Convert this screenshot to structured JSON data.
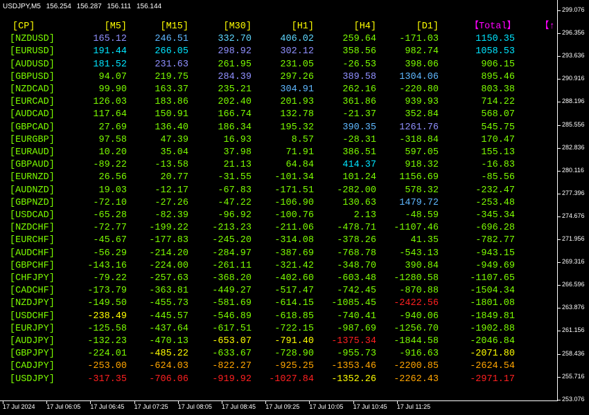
{
  "window": {
    "symbol": "USDJPY,M5",
    "prices": [
      "156.254",
      "156.287",
      "156.111",
      "156.144"
    ]
  },
  "columns": [
    "[CP]",
    "[M5]",
    "[M15]",
    "[M30]",
    "[H1]",
    "[H4]",
    "[D1]",
    "【Total】",
    "【↑"
  ],
  "header_colors": [
    "#ffff00",
    "#ffff00",
    "#ffff00",
    "#ffff00",
    "#ffff00",
    "#ffff00",
    "#ffff00",
    "#ff00ff",
    "#ff00ff"
  ],
  "rows": [
    {
      "pair": "[NZDUSD]",
      "values": [
        "165.12",
        "246.51",
        "332.70",
        "406.02",
        "259.64",
        "-171.03",
        "1150.35"
      ],
      "colors": [
        "#9090ff",
        "#5fb8ff",
        "#5fd8ff",
        "#5fd8ff",
        "#7cfc00",
        "#7cfc00",
        "#00e5ff"
      ]
    },
    {
      "pair": "[EURUSD]",
      "values": [
        "191.44",
        "266.05",
        "298.92",
        "302.12",
        "358.56",
        "982.74",
        "1058.53"
      ],
      "colors": [
        "#00e5ff",
        "#00e5ff",
        "#9090ff",
        "#9090ff",
        "#7cfc00",
        "#7cfc00",
        "#00e5ff"
      ]
    },
    {
      "pair": "[AUDUSD]",
      "values": [
        "181.52",
        "231.63",
        "261.95",
        "231.05",
        "-26.53",
        "398.06",
        "906.15"
      ],
      "colors": [
        "#00e5ff",
        "#9090ff",
        "#7cfc00",
        "#7cfc00",
        "#7cfc00",
        "#7cfc00",
        "#7cfc00"
      ]
    },
    {
      "pair": "[GBPUSD]",
      "values": [
        "94.07",
        "219.75",
        "284.39",
        "297.26",
        "389.58",
        "1304.06",
        "895.46"
      ],
      "colors": [
        "#7cfc00",
        "#7cfc00",
        "#9090ff",
        "#7cfc00",
        "#9090ff",
        "#5fb8ff",
        "#7cfc00"
      ]
    },
    {
      "pair": "[NZDCAD]",
      "values": [
        "99.90",
        "163.37",
        "235.21",
        "304.91",
        "262.16",
        "-220.80",
        "803.38"
      ],
      "colors": [
        "#7cfc00",
        "#7cfc00",
        "#7cfc00",
        "#5fb8ff",
        "#7cfc00",
        "#7cfc00",
        "#7cfc00"
      ]
    },
    {
      "pair": "[EURCAD]",
      "values": [
        "126.03",
        "183.86",
        "202.40",
        "201.93",
        "361.86",
        "939.93",
        "714.22"
      ],
      "colors": [
        "#7cfc00",
        "#7cfc00",
        "#7cfc00",
        "#7cfc00",
        "#7cfc00",
        "#7cfc00",
        "#7cfc00"
      ]
    },
    {
      "pair": "[AUDCAD]",
      "values": [
        "117.64",
        "150.91",
        "166.74",
        "132.78",
        "-21.37",
        "352.84",
        "568.07"
      ],
      "colors": [
        "#7cfc00",
        "#7cfc00",
        "#7cfc00",
        "#7cfc00",
        "#7cfc00",
        "#7cfc00",
        "#7cfc00"
      ]
    },
    {
      "pair": "[GBPCAD]",
      "values": [
        "27.69",
        "136.40",
        "186.34",
        "195.32",
        "390.35",
        "1261.76",
        "545.75"
      ],
      "colors": [
        "#7cfc00",
        "#7cfc00",
        "#7cfc00",
        "#7cfc00",
        "#5fb8ff",
        "#9090ff",
        "#7cfc00"
      ]
    },
    {
      "pair": "[EURGBP]",
      "values": [
        "97.58",
        "47.39",
        "16.93",
        "8.57",
        "-28.31",
        "-318.84",
        "170.47"
      ],
      "colors": [
        "#7cfc00",
        "#7cfc00",
        "#7cfc00",
        "#7cfc00",
        "#7cfc00",
        "#7cfc00",
        "#7cfc00"
      ]
    },
    {
      "pair": "[EURAUD]",
      "values": [
        "10.20",
        "35.04",
        "37.98",
        "71.91",
        "386.51",
        "597.05",
        "155.13"
      ],
      "colors": [
        "#7cfc00",
        "#7cfc00",
        "#7cfc00",
        "#7cfc00",
        "#7cfc00",
        "#7cfc00",
        "#7cfc00"
      ]
    },
    {
      "pair": "[GBPAUD]",
      "values": [
        "-89.22",
        "-13.58",
        "21.13",
        "64.84",
        "414.37",
        "918.32",
        "-16.83"
      ],
      "colors": [
        "#7cfc00",
        "#7cfc00",
        "#7cfc00",
        "#7cfc00",
        "#00e5ff",
        "#7cfc00",
        "#7cfc00"
      ]
    },
    {
      "pair": "[EURNZD]",
      "values": [
        "26.56",
        "20.77",
        "-31.55",
        "-101.34",
        "101.24",
        "1156.69",
        "-85.56"
      ],
      "colors": [
        "#7cfc00",
        "#7cfc00",
        "#7cfc00",
        "#7cfc00",
        "#7cfc00",
        "#7cfc00",
        "#7cfc00"
      ]
    },
    {
      "pair": "[AUDNZD]",
      "values": [
        "19.03",
        "-12.17",
        "-67.83",
        "-171.51",
        "-282.00",
        "578.32",
        "-232.47"
      ],
      "colors": [
        "#7cfc00",
        "#7cfc00",
        "#7cfc00",
        "#7cfc00",
        "#7cfc00",
        "#7cfc00",
        "#7cfc00"
      ]
    },
    {
      "pair": "[GBPNZD]",
      "values": [
        "-72.10",
        "-27.26",
        "-47.22",
        "-106.90",
        "130.63",
        "1479.72",
        "-253.48"
      ],
      "colors": [
        "#7cfc00",
        "#7cfc00",
        "#7cfc00",
        "#7cfc00",
        "#7cfc00",
        "#5fb8ff",
        "#7cfc00"
      ]
    },
    {
      "pair": "[USDCAD]",
      "values": [
        "-65.28",
        "-82.39",
        "-96.92",
        "-100.76",
        "2.13",
        "-48.59",
        "-345.34"
      ],
      "colors": [
        "#7cfc00",
        "#7cfc00",
        "#7cfc00",
        "#7cfc00",
        "#7cfc00",
        "#7cfc00",
        "#7cfc00"
      ]
    },
    {
      "pair": "[NZDCHF]",
      "values": [
        "-72.77",
        "-199.22",
        "-213.23",
        "-211.06",
        "-478.71",
        "-1107.46",
        "-696.28"
      ],
      "colors": [
        "#7cfc00",
        "#7cfc00",
        "#7cfc00",
        "#7cfc00",
        "#7cfc00",
        "#7cfc00",
        "#7cfc00"
      ]
    },
    {
      "pair": "[EURCHF]",
      "values": [
        "-45.67",
        "-177.83",
        "-245.20",
        "-314.08",
        "-378.26",
        "41.35",
        "-782.77"
      ],
      "colors": [
        "#7cfc00",
        "#7cfc00",
        "#7cfc00",
        "#7cfc00",
        "#7cfc00",
        "#7cfc00",
        "#7cfc00"
      ]
    },
    {
      "pair": "[AUDCHF]",
      "values": [
        "-56.29",
        "-214.20",
        "-284.97",
        "-387.69",
        "-768.78",
        "-543.13",
        "-943.15"
      ],
      "colors": [
        "#7cfc00",
        "#7cfc00",
        "#7cfc00",
        "#7cfc00",
        "#7cfc00",
        "#7cfc00",
        "#7cfc00"
      ]
    },
    {
      "pair": "[GBPCHF]",
      "values": [
        "-143.16",
        "-224.00",
        "-261.11",
        "-321.42",
        "-348.70",
        "390.84",
        "-949.69"
      ],
      "colors": [
        "#7cfc00",
        "#7cfc00",
        "#7cfc00",
        "#7cfc00",
        "#7cfc00",
        "#7cfc00",
        "#7cfc00"
      ]
    },
    {
      "pair": "[CHFJPY]",
      "values": [
        "-79.22",
        "-257.63",
        "-368.20",
        "-402.60",
        "-603.48",
        "-1280.58",
        "-1107.65"
      ],
      "colors": [
        "#7cfc00",
        "#7cfc00",
        "#7cfc00",
        "#7cfc00",
        "#7cfc00",
        "#7cfc00",
        "#7cfc00"
      ]
    },
    {
      "pair": "[CADCHF]",
      "values": [
        "-173.79",
        "-363.81",
        "-449.27",
        "-517.47",
        "-742.45",
        "-870.88",
        "-1504.34"
      ],
      "colors": [
        "#7cfc00",
        "#7cfc00",
        "#7cfc00",
        "#7cfc00",
        "#7cfc00",
        "#7cfc00",
        "#7cfc00"
      ]
    },
    {
      "pair": "[NZDJPY]",
      "values": [
        "-149.50",
        "-455.73",
        "-581.69",
        "-614.15",
        "-1085.45",
        "-2422.56",
        "-1801.08"
      ],
      "colors": [
        "#7cfc00",
        "#7cfc00",
        "#7cfc00",
        "#7cfc00",
        "#7cfc00",
        "#ff2020",
        "#7cfc00"
      ]
    },
    {
      "pair": "[USDCHF]",
      "values": [
        "-238.49",
        "-445.57",
        "-546.89",
        "-618.85",
        "-740.41",
        "-940.06",
        "-1849.81"
      ],
      "colors": [
        "#ffff00",
        "#7cfc00",
        "#7cfc00",
        "#7cfc00",
        "#7cfc00",
        "#7cfc00",
        "#7cfc00"
      ]
    },
    {
      "pair": "[EURJPY]",
      "values": [
        "-125.58",
        "-437.64",
        "-617.51",
        "-722.15",
        "-987.69",
        "-1256.70",
        "-1902.88"
      ],
      "colors": [
        "#7cfc00",
        "#7cfc00",
        "#7cfc00",
        "#7cfc00",
        "#7cfc00",
        "#7cfc00",
        "#7cfc00"
      ]
    },
    {
      "pair": "[AUDJPY]",
      "values": [
        "-132.23",
        "-470.13",
        "-653.07",
        "-791.40",
        "-1375.34",
        "-1844.58",
        "-2046.84"
      ],
      "colors": [
        "#7cfc00",
        "#7cfc00",
        "#ffff00",
        "#ffff00",
        "#ff2020",
        "#7cfc00",
        "#7cfc00"
      ]
    },
    {
      "pair": "[GBPJPY]",
      "values": [
        "-224.01",
        "-485.22",
        "-633.67",
        "-728.90",
        "-955.73",
        "-916.63",
        "-2071.80"
      ],
      "colors": [
        "#7cfc00",
        "#ffff00",
        "#7cfc00",
        "#7cfc00",
        "#7cfc00",
        "#7cfc00",
        "#ffff00"
      ]
    },
    {
      "pair": "[CADJPY]",
      "values": [
        "-253.00",
        "-624.03",
        "-822.27",
        "-925.25",
        "-1353.46",
        "-2200.85",
        "-2624.54"
      ],
      "colors": [
        "#ffa500",
        "#ffa500",
        "#ffa500",
        "#ffa500",
        "#ffa500",
        "#ffa500",
        "#ffa500"
      ]
    },
    {
      "pair": "[USDJPY]",
      "values": [
        "-317.35",
        "-706.06",
        "-919.92",
        "-1027.84",
        "-1352.26",
        "-2262.43",
        "-2971.17"
      ],
      "colors": [
        "#ff2020",
        "#ff2020",
        "#ff2020",
        "#ff2020",
        "#ffff00",
        "#ffa500",
        "#ff2020"
      ]
    }
  ],
  "price_axis": [
    "299.076",
    "296.356",
    "293.636",
    "290.916",
    "288.196",
    "285.556",
    "282.836",
    "280.116",
    "277.396",
    "274.676",
    "271.956",
    "269.316",
    "266.596",
    "263.876",
    "261.156",
    "258.436",
    "255.716",
    "253.076"
  ],
  "time_axis": [
    "17 Jul 2024",
    "17 Jul 06:05",
    "17 Jul 06:45",
    "17 Jul 07:25",
    "17 Jul 08:05",
    "17 Jul 08:45",
    "17 Jul 09:25",
    "17 Jul 10:05",
    "17 Jul 10:45",
    "17 Jul 11:25"
  ],
  "colors": {
    "background": "#000000",
    "header": "#ffff00",
    "total_header": "#ff00ff",
    "symbol": "#7cfc00",
    "axis_text": "#ffffff"
  }
}
